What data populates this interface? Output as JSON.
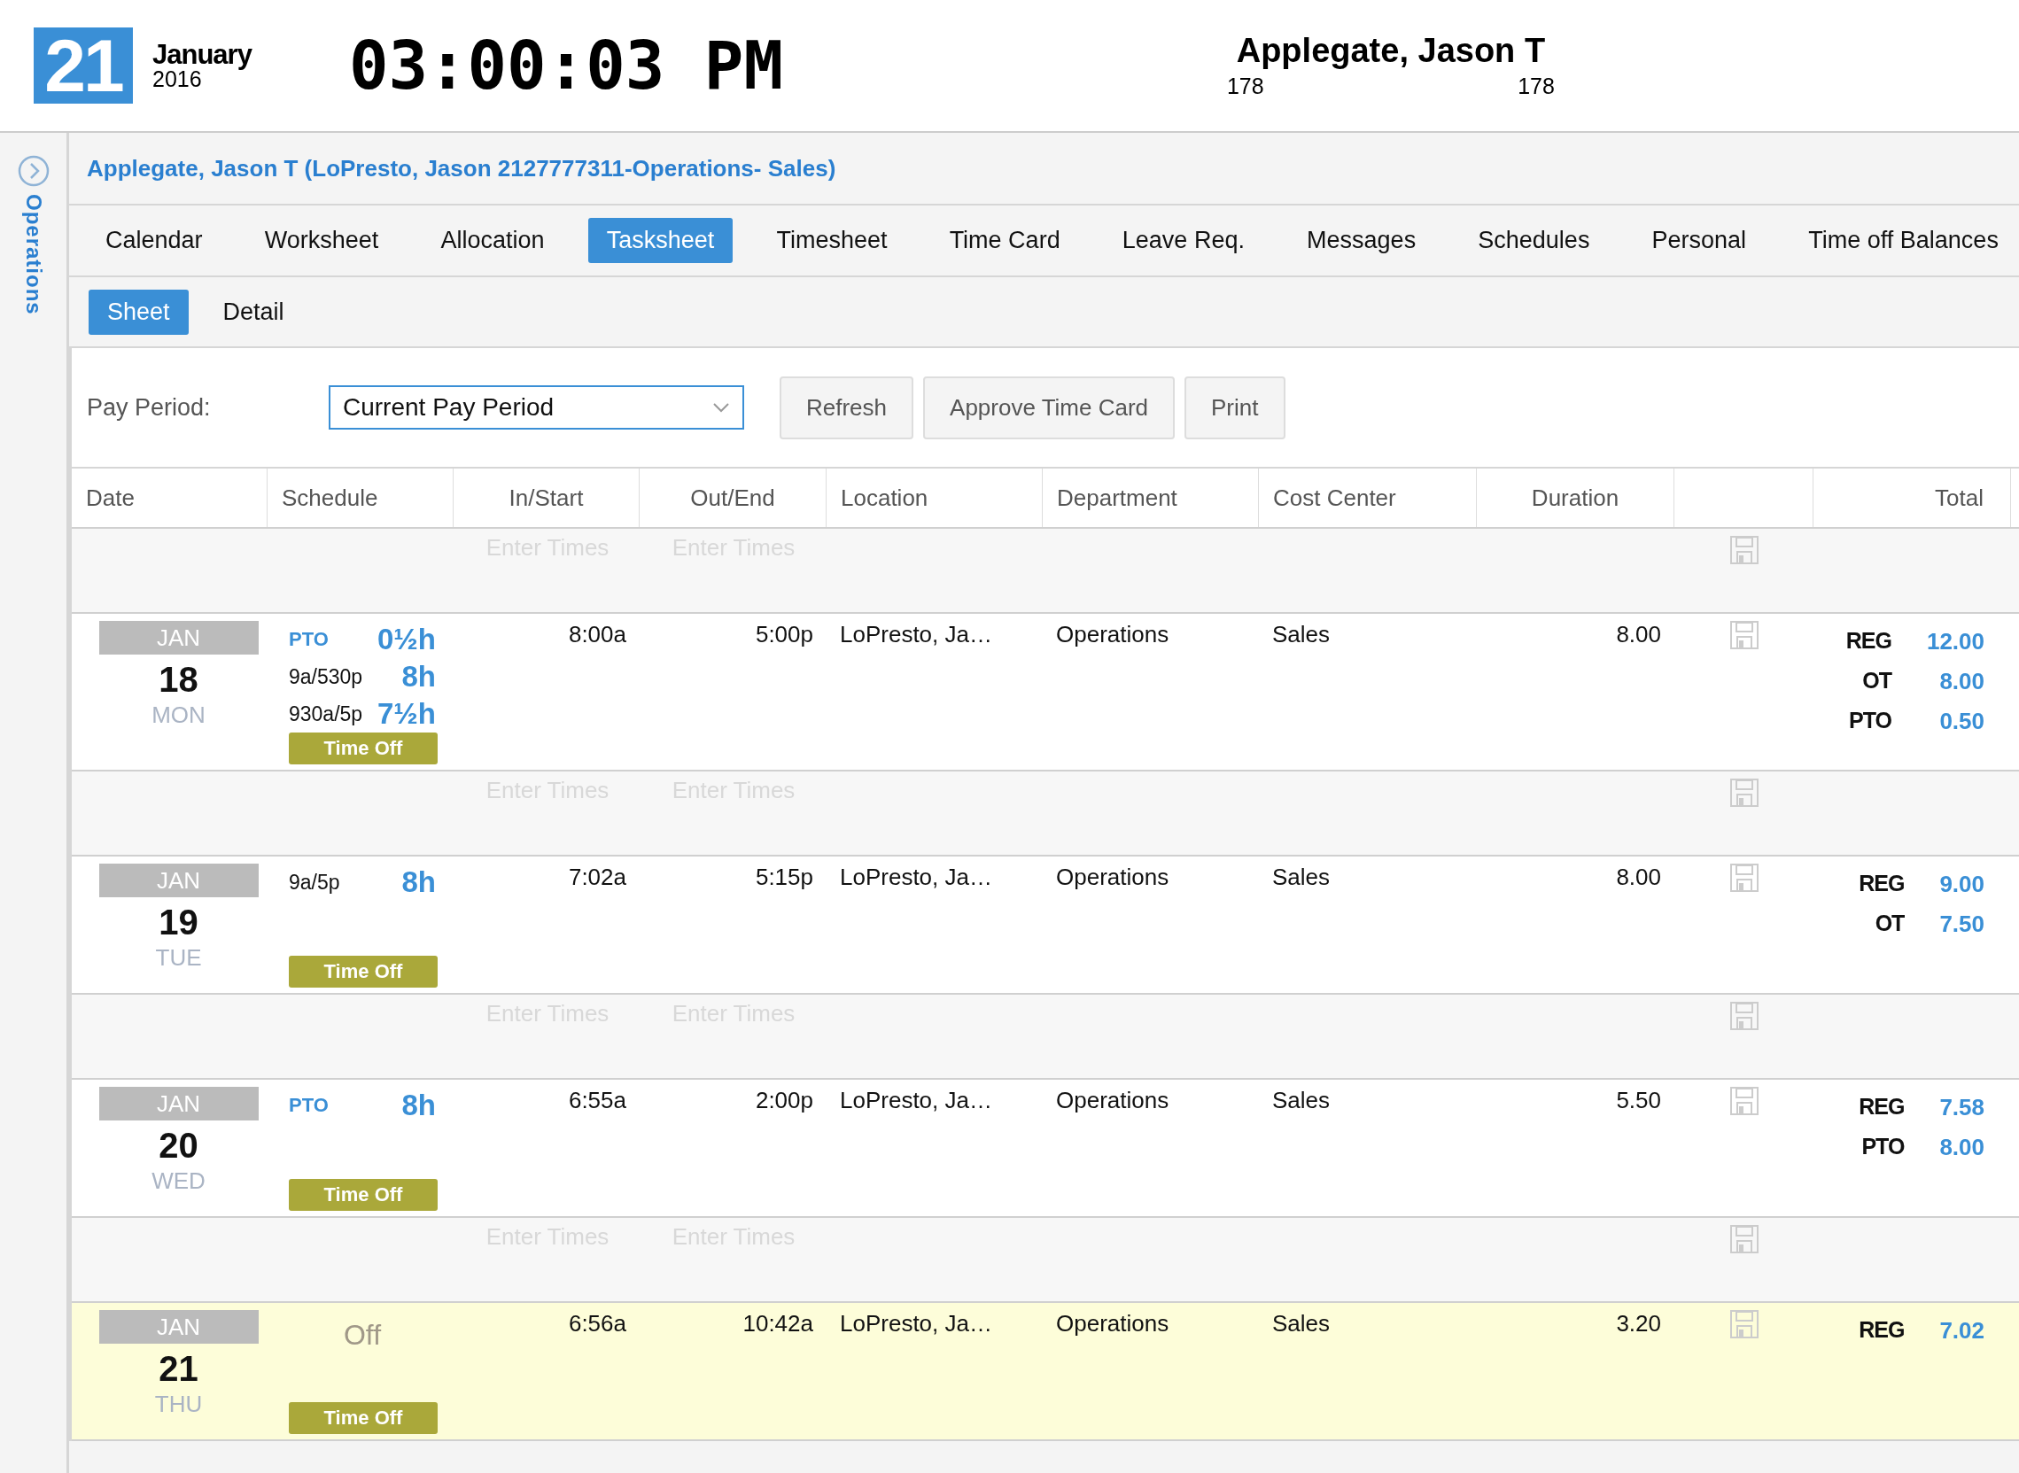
{
  "header": {
    "day": "21",
    "month": "January",
    "year": "2016",
    "clock": "03:00:03 PM",
    "user_name": "Applegate, Jason T",
    "user_codes": [
      "178",
      "178"
    ]
  },
  "sidebar": {
    "label": "Operations"
  },
  "employee_title": "Applegate, Jason T (LoPresto, Jason 2127777311-Operations- Sales)",
  "tabs": [
    {
      "label": "Calendar",
      "selected": false
    },
    {
      "label": "Worksheet",
      "selected": false
    },
    {
      "label": "Allocation",
      "selected": false
    },
    {
      "label": "Tasksheet",
      "selected": true
    },
    {
      "label": "Timesheet",
      "selected": false
    },
    {
      "label": "Time Card",
      "selected": false
    },
    {
      "label": "Leave Req.",
      "selected": false
    },
    {
      "label": "Messages",
      "selected": false
    },
    {
      "label": "Schedules",
      "selected": false
    },
    {
      "label": "Personal",
      "selected": false
    },
    {
      "label": "Time off Balances",
      "selected": false
    }
  ],
  "subtabs": [
    {
      "label": "Sheet",
      "selected": true
    },
    {
      "label": "Detail",
      "selected": false
    }
  ],
  "pay_period": {
    "label": "Pay Period:",
    "value": "Current Pay Period"
  },
  "buttons": [
    "Refresh",
    "Approve Time Card",
    "Print"
  ],
  "table": {
    "columns": [
      {
        "label": "Date"
      },
      {
        "label": "Schedule"
      },
      {
        "label": "In/Start"
      },
      {
        "label": "Out/End"
      },
      {
        "label": "Location"
      },
      {
        "label": "Department"
      },
      {
        "label": "Cost Center"
      },
      {
        "label": "Duration"
      },
      {},
      {
        "label": "Total"
      }
    ],
    "rows": [
      {
        "kind": "entry",
        "in_placeholder": "Enter Times",
        "out_placeholder": "Enter Times"
      },
      {
        "kind": "day",
        "today": false,
        "month": "JAN",
        "day": "18",
        "weekday": "MON",
        "schedule": [
          {
            "kind": "pto",
            "label": "PTO",
            "hours": "0½h"
          },
          {
            "kind": "shift",
            "label": "9a/530p",
            "hours": "8h"
          },
          {
            "kind": "shift",
            "label": "930a/5p",
            "hours": "7½h"
          }
        ],
        "badge": "Time Off",
        "in": "8:00a",
        "out": "5:00p",
        "location": "LoPresto, Ja…",
        "department": "Operations",
        "cost_center": "Sales",
        "duration": "8.00",
        "totals": [
          {
            "code": "REG",
            "value": "12.00"
          },
          {
            "code": "OT",
            "value": "8.00"
          },
          {
            "code": "PTO",
            "value": "0.50"
          }
        ]
      },
      {
        "kind": "entry",
        "in_placeholder": "Enter Times",
        "out_placeholder": "Enter Times"
      },
      {
        "kind": "day",
        "today": false,
        "month": "JAN",
        "day": "19",
        "weekday": "TUE",
        "schedule": [
          {
            "kind": "shift",
            "label": "9a/5p",
            "hours": "8h"
          }
        ],
        "badge": "Time Off",
        "in": "7:02a",
        "out": "5:15p",
        "location": "LoPresto, Ja…",
        "department": "Operations",
        "cost_center": "Sales",
        "duration": "8.00",
        "totals": [
          {
            "code": "REG",
            "value": "9.00"
          },
          {
            "code": "OT",
            "value": "7.50"
          }
        ]
      },
      {
        "kind": "entry",
        "in_placeholder": "Enter Times",
        "out_placeholder": "Enter Times"
      },
      {
        "kind": "day",
        "today": false,
        "month": "JAN",
        "day": "20",
        "weekday": "WED",
        "schedule": [
          {
            "kind": "pto",
            "label": "PTO",
            "hours": "8h"
          }
        ],
        "badge": "Time Off",
        "in": "6:55a",
        "out": "2:00p",
        "location": "LoPresto, Ja…",
        "department": "Operations",
        "cost_center": "Sales",
        "duration": "5.50",
        "totals": [
          {
            "code": "REG",
            "value": "7.58"
          },
          {
            "code": "PTO",
            "value": "8.00"
          }
        ]
      },
      {
        "kind": "entry",
        "in_placeholder": "Enter Times",
        "out_placeholder": "Enter Times"
      },
      {
        "kind": "day",
        "today": true,
        "month": "JAN",
        "day": "21",
        "weekday": "THU",
        "schedule": [
          {
            "kind": "off",
            "label": "Off"
          }
        ],
        "badge": "Time Off",
        "in": "6:56a",
        "out": "10:42a",
        "location": "LoPresto, Ja…",
        "department": "Operations",
        "cost_center": "Sales",
        "duration": "3.20",
        "totals": [
          {
            "code": "REG",
            "value": "7.02"
          }
        ]
      }
    ]
  }
}
